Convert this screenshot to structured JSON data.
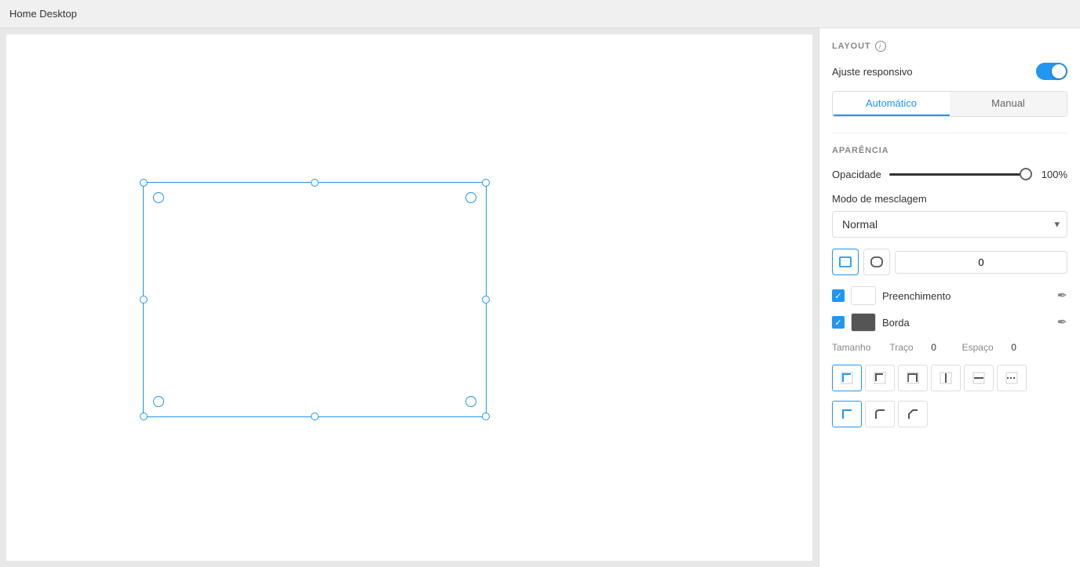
{
  "topbar": {
    "title": "Home Desktop"
  },
  "panel": {
    "layout_section": "LAYOUT",
    "responsive_label": "Ajuste responsivo",
    "tab_auto": "Automático",
    "tab_manual": "Manual",
    "appearance_section": "APARÊNCIA",
    "opacity_label": "Opacidade",
    "opacity_value": "100%",
    "blend_label": "Modo de mesclagem",
    "blend_value": "Normal",
    "shape_value": "0",
    "fill_label": "Preenchimento",
    "border_label": "Borda",
    "border_size_label": "Tamanho",
    "border_trace_label": "Traço",
    "border_trace_value": "0",
    "border_space_label": "Espaço",
    "border_space_value": "0"
  }
}
